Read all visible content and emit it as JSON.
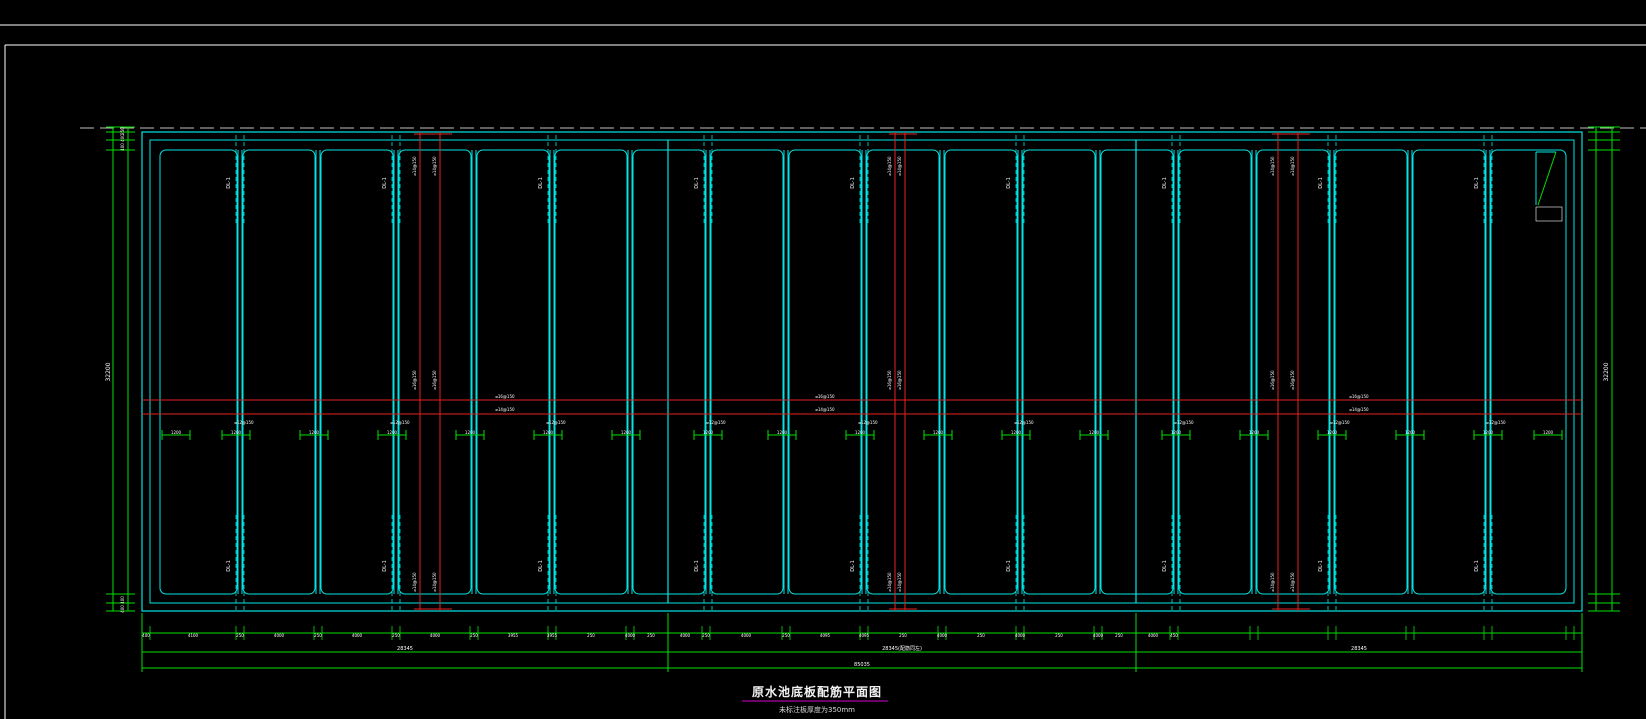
{
  "drawing": {
    "title": "原水池底板配筋平面图",
    "subtitle": "未标注板厚度为350mm"
  },
  "dimensions": {
    "bottom_row1": [
      "400",
      "4100",
      "250",
      "4000",
      "250",
      "4000",
      "250",
      "4000",
      "250",
      "3955",
      "3955",
      "250",
      "4000",
      "250",
      "4000",
      "250",
      "4000",
      "250",
      "4095",
      "4095",
      "250",
      "4000",
      "250",
      "4000",
      "250",
      "4000",
      "250",
      "4000",
      "450"
    ],
    "bottom_row2": [
      "28345",
      "28345(配筋同左)",
      "28345"
    ],
    "bottom_total": "85035",
    "left_total": "32200",
    "left_small": [
      "250",
      "400",
      "400",
      "400",
      "400",
      "250"
    ],
    "right_total": "32200",
    "rebar_bottom": "1200"
  },
  "labels": {
    "beam": "DL-1",
    "rebar_main": "⌀16@150",
    "rebar_cross": "⌀14@150",
    "rebar_add": "⌀12@150"
  },
  "colors": {
    "frame": "#ffffff",
    "wall": "#00e5e5",
    "rebar": "#e62020",
    "dimension": "#00e000",
    "title_line": "#d000d0"
  }
}
